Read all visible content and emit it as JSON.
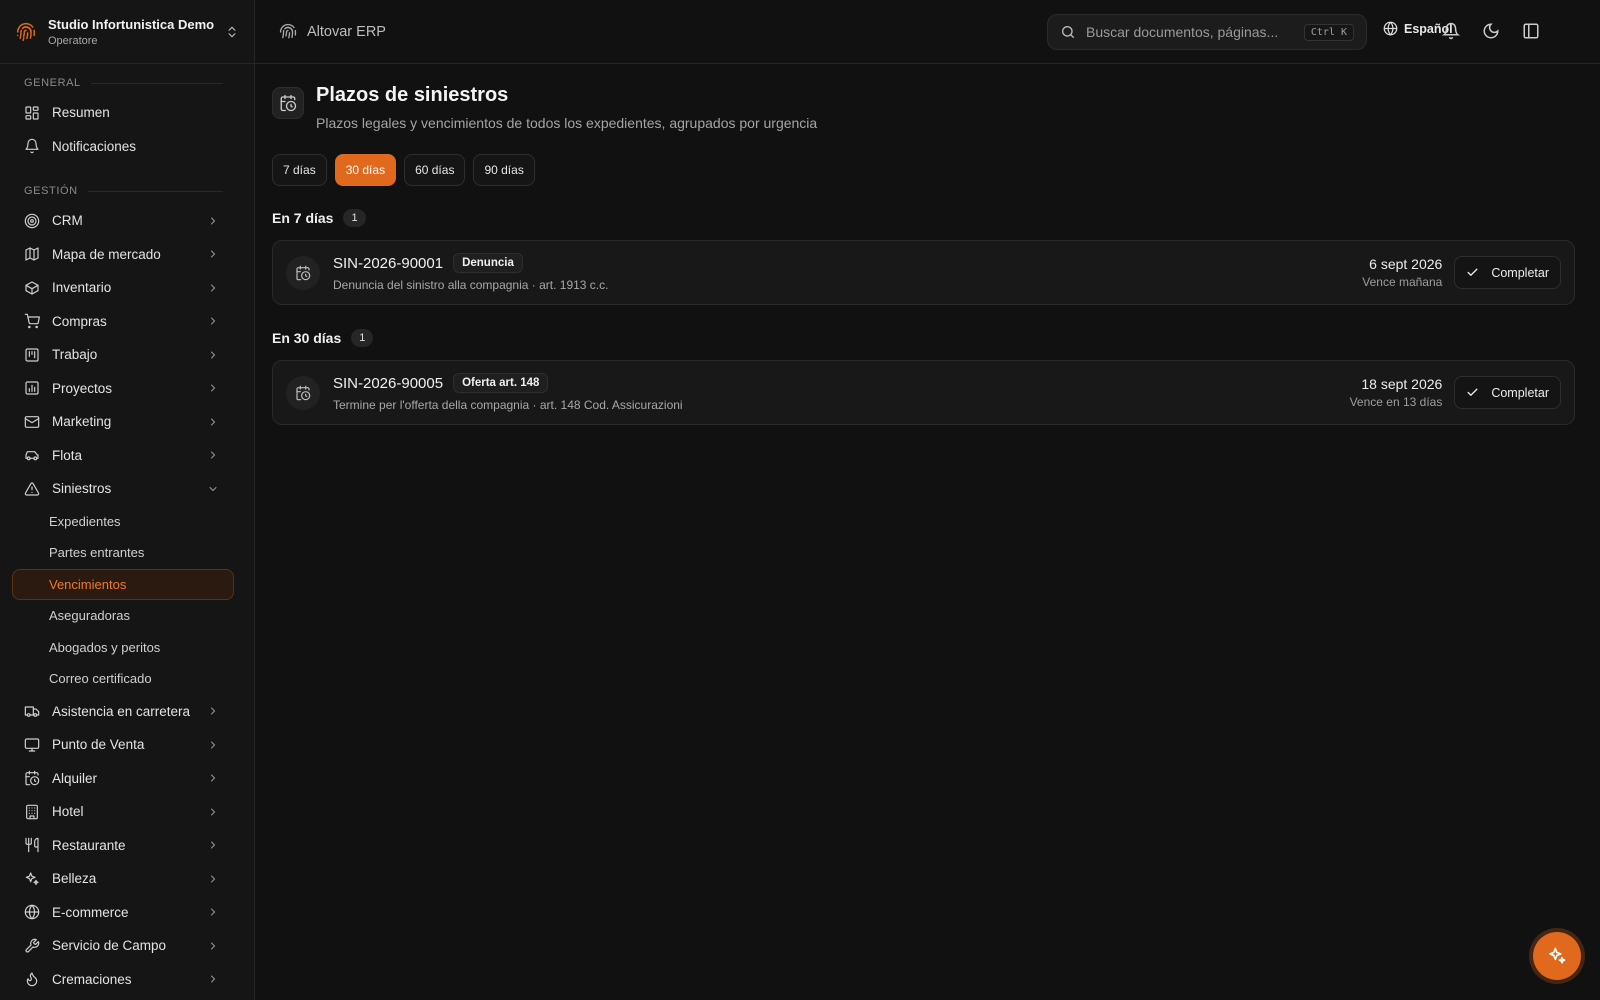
{
  "org": {
    "name": "Studio Infortunistica Demo",
    "role": "Operatore"
  },
  "topbar": {
    "brand": "Altovar ERP",
    "search_placeholder": "Buscar documentos, páginas...",
    "shortcut": "Ctrl K",
    "language": "Español"
  },
  "sidebar": {
    "section_general": "GENERAL",
    "section_gestion": "GESTIÓN",
    "general_items": [
      {
        "label": "Resumen",
        "icon": "dashboard-icon"
      },
      {
        "label": "Notificaciones",
        "icon": "bell-icon"
      }
    ],
    "gestion_items": [
      {
        "label": "CRM",
        "icon": "target-icon"
      },
      {
        "label": "Mapa de mercado",
        "icon": "map-icon"
      },
      {
        "label": "Inventario",
        "icon": "box-icon"
      },
      {
        "label": "Compras",
        "icon": "cart-icon"
      },
      {
        "label": "Trabajo",
        "icon": "kanban-icon"
      },
      {
        "label": "Proyectos",
        "icon": "chart-icon"
      },
      {
        "label": "Marketing",
        "icon": "mail-icon"
      },
      {
        "label": "Flota",
        "icon": "car-icon"
      },
      {
        "label": "Siniestros",
        "icon": "warning-icon"
      }
    ],
    "siniestros_sub": [
      {
        "label": "Expedientes"
      },
      {
        "label": "Partes entrantes"
      },
      {
        "label": "Vencimientos"
      },
      {
        "label": "Aseguradoras"
      },
      {
        "label": "Abogados y peritos"
      },
      {
        "label": "Correo certificado"
      }
    ],
    "more_items": [
      {
        "label": "Asistencia en carretera",
        "icon": "truck-icon"
      },
      {
        "label": "Punto de Venta",
        "icon": "monitor-icon"
      },
      {
        "label": "Alquiler",
        "icon": "calendar-clock-icon"
      },
      {
        "label": "Hotel",
        "icon": "building-icon"
      },
      {
        "label": "Restaurante",
        "icon": "utensils-icon"
      },
      {
        "label": "Belleza",
        "icon": "sparkles-icon"
      },
      {
        "label": "E-commerce",
        "icon": "globe-icon"
      },
      {
        "label": "Servicio de Campo",
        "icon": "wrench-icon"
      },
      {
        "label": "Cremaciones",
        "icon": "flame-icon"
      }
    ]
  },
  "page": {
    "title": "Plazos de siniestros",
    "subtitle": "Plazos legales y vencimientos de todos los expedientes, agrupados por urgencia",
    "filters": [
      "7 días",
      "30 días",
      "60 días",
      "90 días"
    ],
    "active_filter": "30 días",
    "complete_label": "Completar",
    "groups": [
      {
        "title": "En 7 días",
        "count": "1",
        "items": [
          {
            "id": "SIN-2026-90001",
            "tag": "Denuncia",
            "desc": "Denuncia del sinistro alla compagnia · art. 1913 c.c.",
            "date": "6 sept 2026",
            "due": "Vence mañana"
          }
        ]
      },
      {
        "title": "En 30 días",
        "count": "1",
        "items": [
          {
            "id": "SIN-2026-90005",
            "tag": "Oferta art. 148",
            "desc": "Termine per l'offerta della compagnia · art. 148 Cod. Assicurazioni",
            "date": "18 sept 2026",
            "due": "Vence en 13 días"
          }
        ]
      }
    ]
  },
  "colors": {
    "accent": "#e0691d",
    "background": "#111111",
    "sidebar": "#151515"
  }
}
